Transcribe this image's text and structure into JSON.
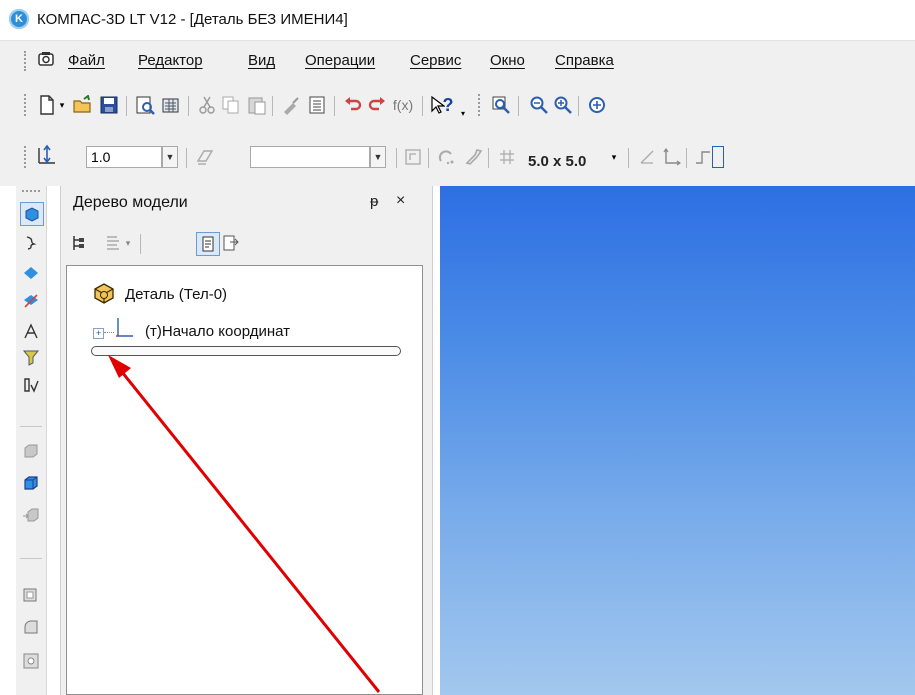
{
  "window": {
    "title": "КОМПАС-3D LT V12 - [Деталь БЕЗ ИМЕНИ4]",
    "logo_glyph": "K"
  },
  "menu": {
    "items": [
      {
        "label": "Файл"
      },
      {
        "label": "Редактор"
      },
      {
        "label": "Вид"
      },
      {
        "label": "Операции"
      },
      {
        "label": "Сервис"
      },
      {
        "label": "Окно"
      },
      {
        "label": "Справка"
      }
    ]
  },
  "toolbar2": {
    "scale_value": "1.0",
    "grid_value": "5.0 x 5.0",
    "fx_label": "f(x)",
    "help_label": "?"
  },
  "tree_panel": {
    "title": "Дерево модели",
    "pin_glyph": "ᵽ",
    "close_glyph": "×",
    "root_label": "Деталь (Тел-0)",
    "child_label": "(т)Начало координат",
    "expand_glyph": "+"
  },
  "colors": {
    "accent_blue": "#2d6fe3",
    "annotation_arrow": "#e00000"
  }
}
